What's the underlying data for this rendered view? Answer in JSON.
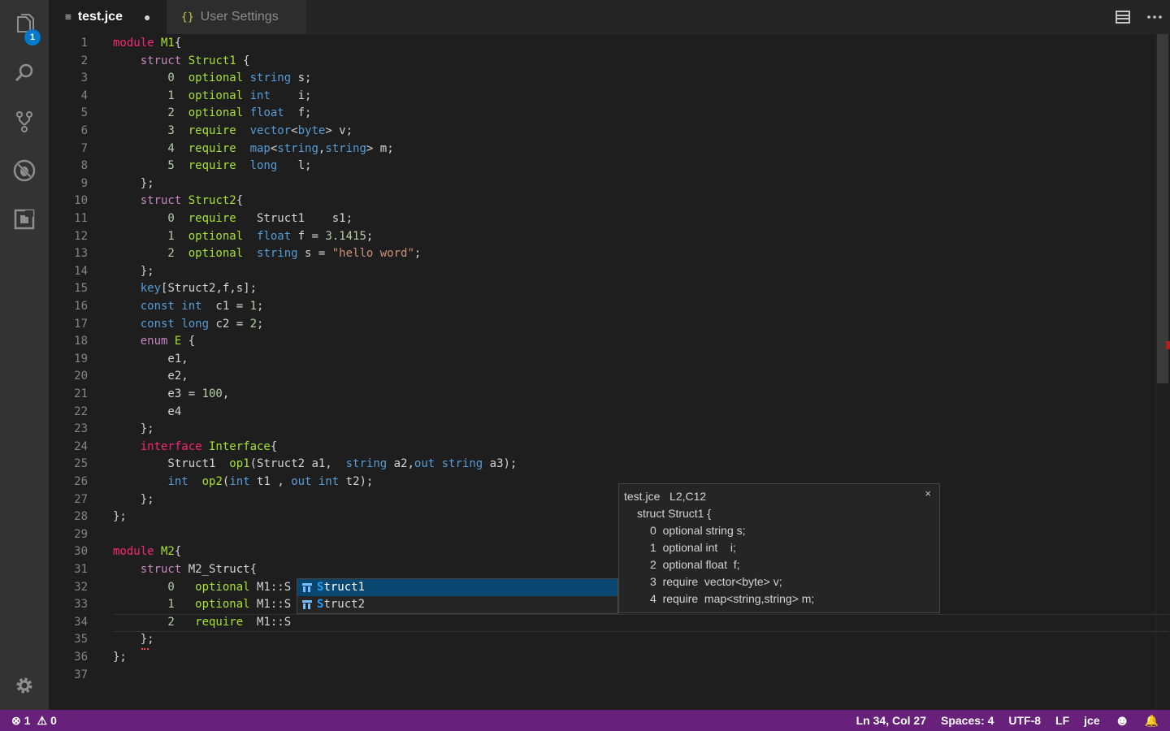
{
  "activity_bar": {
    "explorer_badge": "1",
    "icons": [
      "files-icon",
      "search-icon",
      "source-control-icon",
      "debug-icon",
      "extensions-icon",
      "gear-icon"
    ]
  },
  "tabs": [
    {
      "label": "test.jce",
      "icon": "≡",
      "dirty": "●"
    },
    {
      "label": "User Settings",
      "icon": "{}"
    }
  ],
  "code_lines": [
    "1",
    "2",
    "3",
    "4",
    "5",
    "6",
    "7",
    "8",
    "9",
    "10",
    "11",
    "12",
    "13",
    "14",
    "15",
    "16",
    "17",
    "18",
    "19",
    "20",
    "21",
    "22",
    "23",
    "24",
    "25",
    "26",
    "27",
    "28",
    "29",
    "30",
    "31",
    "32",
    "33",
    "34",
    "35",
    "36",
    "37"
  ],
  "code": {
    "l1": {
      "a": "module",
      "b": " M1",
      "c": "{"
    },
    "l2": {
      "a": "    struct",
      "b": " Struct1",
      "c": " {"
    },
    "l3": {
      "a": "        0",
      "b": "  optional",
      "c": " string",
      "d": " s;"
    },
    "l4": {
      "a": "        1",
      "b": "  optional",
      "c": " int",
      "d": "    i;"
    },
    "l5": {
      "a": "        2",
      "b": "  optional",
      "c": " float",
      "d": "  f;"
    },
    "l6": {
      "a": "        3",
      "b": "  require",
      "c": "  vector",
      "d": "<",
      "e": "byte",
      "f": "> v;"
    },
    "l7": {
      "a": "        4",
      "b": "  require",
      "c": "  map",
      "d": "<",
      "e": "string",
      "f": ",",
      "g": "string",
      "h": "> m;"
    },
    "l8": {
      "a": "        5",
      "b": "  require",
      "c": "  long",
      "d": "   l;"
    },
    "l9": {
      "a": "    };"
    },
    "l10": {
      "a": "    struct",
      "b": " Struct2",
      "c": "{"
    },
    "l11": {
      "a": "        0",
      "b": "  require",
      "c": "   Struct1    s1;"
    },
    "l12": {
      "a": "        1",
      "b": "  optional",
      "c": "  float",
      "d": " f = ",
      "e": "3.1415",
      "f": ";"
    },
    "l13": {
      "a": "        2",
      "b": "  optional",
      "c": "  string",
      "d": " s = ",
      "e": "\"hello word\"",
      "f": ";"
    },
    "l14": {
      "a": "    };"
    },
    "l15": {
      "a": "    key",
      "b": "[Struct2,f,s];"
    },
    "l16": {
      "a": "    const",
      "b": " int",
      "c": "  c1 = ",
      "d": "1",
      "e": ";"
    },
    "l17": {
      "a": "    const",
      "b": " long",
      "c": " c2 = ",
      "d": "2",
      "e": ";"
    },
    "l18": {
      "a": "    enum",
      "b": " E",
      "c": " {"
    },
    "l19": {
      "a": "        e1,"
    },
    "l20": {
      "a": "        e2,"
    },
    "l21": {
      "a": "        e3 = ",
      "b": "100",
      "c": ","
    },
    "l22": {
      "a": "        e4"
    },
    "l23": {
      "a": "    };"
    },
    "l24": {
      "a": "    interface",
      "b": " Interface",
      "c": "{"
    },
    "l25": {
      "a": "        Struct1  ",
      "b": "op1",
      "c": "(Struct2 a1,  ",
      "d": "string",
      "e": " a2,",
      "f": "out",
      "g": " string",
      "h": " a3);"
    },
    "l26": {
      "a": "        ",
      "b": "int",
      "c": "  op2",
      "d": "(",
      "e": "int",
      "f": " t1 , ",
      "g": "out",
      "h": " int",
      "i": " t2);"
    },
    "l27": {
      "a": "    };"
    },
    "l28": {
      "a": "};"
    },
    "l29": {
      "a": ""
    },
    "l30": {
      "a": "module",
      "b": " M2",
      "c": "{"
    },
    "l31": {
      "a": "    struct",
      "b": " M2_Struct{"
    },
    "l32": {
      "a": "        0",
      "b": "   optional",
      "c": " M1::S"
    },
    "l33": {
      "a": "        1",
      "b": "   optional",
      "c": " M1::S"
    },
    "l34": {
      "a": "        2",
      "b": "   require",
      "c": "  M1::S"
    },
    "l35": {
      "a": "    };"
    },
    "l36": {
      "a": "};"
    },
    "l37": {
      "a": ""
    }
  },
  "suggest": {
    "items": [
      {
        "hl": "S",
        "rest": "truct1"
      },
      {
        "hl": "S",
        "rest": "truct2"
      }
    ]
  },
  "docs": {
    "file": "test.jce",
    "position": "L2,C12",
    "close": "×",
    "lines": [
      "struct Struct1 {",
      "0  optional string s;",
      "1  optional int    i;",
      "2  optional float  f;",
      "3  require  vector<byte> v;",
      "4  require  map<string,string> m;"
    ]
  },
  "status": {
    "errors_icon": "⊗",
    "errors": "1",
    "warnings_icon": "⚠",
    "warnings": "0",
    "position": "Ln 34, Col 27",
    "spaces": "Spaces: 4",
    "encoding": "UTF-8",
    "eol": "LF",
    "language": "jce",
    "feedback_icon": "☻",
    "bell_icon": "🔔"
  },
  "colors": {
    "accent": "#007acc",
    "statusbar": "#68217a",
    "selection": "#094771"
  }
}
